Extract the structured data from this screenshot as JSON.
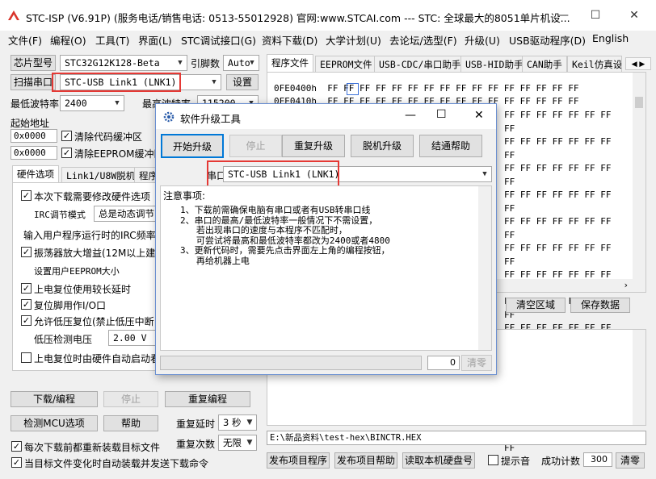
{
  "window": {
    "title": "STC-ISP (V6.91P) (服务电话/销售电话: 0513-55012928) 官网:www.STCAI.com  --- STC: 全球最大的8051单片机设...",
    "minimize": "—",
    "maximize": "☐",
    "close": "✕"
  },
  "menu": [
    "文件(F)",
    "编程(O)",
    "工具(T)",
    "界面(L)",
    "STC调试接口(G)",
    "资料下载(D)",
    "大学计划(U)",
    "去论坛/选型(F)",
    "升级(U)",
    "USB驱动程序(D)",
    "English"
  ],
  "left": {
    "chip_label": "芯片型号",
    "chip_value": "STC32G12K128-Beta",
    "pins_label": "引脚数",
    "pins_value": "Auto",
    "scan_button": "扫描串口",
    "port_value": "STC-USB Link1 (LNK1)",
    "settings_button": "设置",
    "min_baud_label": "最低波特率",
    "min_baud_value": "2400",
    "max_baud_label": "最高波特率",
    "max_baud_value": "115200",
    "start_addr_label": "起始地址",
    "addr1": "0x0000",
    "clear_code": "清除代码缓冲区",
    "addr2": "0x0000",
    "clear_eeprom": "清除EEPROM缓冲区",
    "tabs": [
      "硬件选项",
      "Link1/U8W脱机",
      "程序"
    ],
    "options": {
      "opt1": "本次下载需要修改硬件选项",
      "irc_label": "IRC调节模式",
      "irc_value": "总是动态调节",
      "irc_input_label": "输入用户程序运行时的IRC频率",
      "osc": "振荡器放大增益(12M以上建议",
      "eeprom_label": "设置用户EEPROM大小",
      "power_delay": "上电复位使用较长延时",
      "reset_pin": "复位脚用作I/O口",
      "lvr": "允许低压复位(禁止低压中断",
      "lvd_label": "低压检测电压",
      "lvd_value": "2.00 V",
      "hw_wdt": "上电复位时由硬件自动启动看"
    },
    "download_button": "下载/编程",
    "stop_button": "停止",
    "reprogram_button": "重复编程",
    "detect_button": "检测MCU选项",
    "help_button": "帮助",
    "repeat_delay_label": "重复延时",
    "repeat_delay_value": "3 秒",
    "repeat_count_label": "重复次数",
    "repeat_count_value": "无限",
    "reload_each": "每次下载前都重新装载目标文件",
    "auto_reload": "当目标文件变化时自动装载并发送下载命令"
  },
  "right": {
    "tabs": [
      "程序文件",
      "EEPROM文件",
      "USB-CDC/串口助手",
      "USB-HID助手",
      "CAN助手",
      "Keil仿真设"
    ],
    "hex_rows": [
      {
        "addr": "0FE0400h",
        "bytes": "FF FF FF FF FF FF FF FF FF FF FF FF FF FF FF FF"
      },
      {
        "addr": "0FE0410h",
        "bytes": "FF FF FF FF FF FF FF FF FF FF FF FF FF FF FF FF"
      }
    ],
    "hex_partial": "FF FF FF FF FF FF FF FF",
    "clear_button": "清空区域",
    "save_button": "保存数据",
    "file_path": "E:\\新品资料\\test-hex\\BINCTR.HEX",
    "publish_button": "发布项目程序",
    "publish_help_button": "发布项目帮助",
    "read_serial_button": "读取本机硬盘号",
    "beep_label": "提示音",
    "count_label": "成功计数",
    "count_value": "300",
    "clear_count_button": "清零"
  },
  "dialog": {
    "title": "软件升级工具",
    "buttons": {
      "start": "开始升级",
      "stop": "停止",
      "repeat": "重复升级",
      "offline": "脱机升级",
      "help": "结通帮助"
    },
    "port_label": "串口",
    "port_value": "STC-USB Link1 (LNK1)",
    "notes_title": "注意事项:",
    "notes": [
      "1、下载前需确保电脑有串口或者有USB转串口线",
      "2、串口的最高/最低波特率一般情况下不需设置，",
      "   若出现串口的速度与本程序不匹配时，",
      "   可尝试将最高和最低波特率都改为2400或者4800",
      "3、更新代码时，需要先点击界面左上角的编程按钮，",
      "   再给机器上电"
    ],
    "progress_count": "0",
    "clear_button": "清零"
  },
  "colors": {
    "accent_red": "#e53935",
    "dialog_border": "#6a8fd1"
  }
}
